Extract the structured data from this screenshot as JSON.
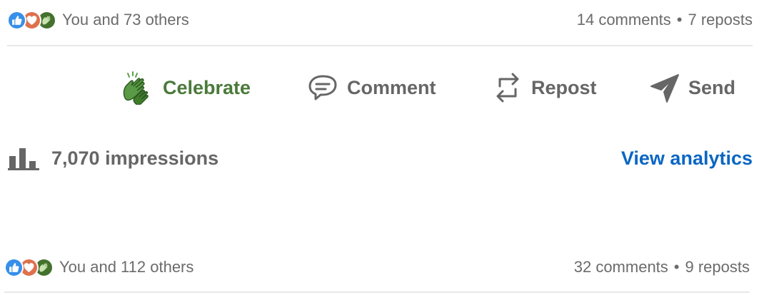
{
  "posts": [
    {
      "reactions_text": "You and 73 others",
      "comments": "14 comments",
      "separator": "•",
      "reposts": "7 reposts"
    },
    {
      "reactions_text": "You and 112 others",
      "comments": "32 comments",
      "separator": "•",
      "reposts": "9 reposts"
    }
  ],
  "actions": {
    "celebrate": {
      "label": "Celebrate",
      "icon": "celebrate-icon",
      "active": true
    },
    "comment": {
      "label": "Comment",
      "icon": "comment-icon"
    },
    "repost": {
      "label": "Repost",
      "icon": "repost-icon"
    },
    "send": {
      "label": "Send",
      "icon": "send-icon"
    }
  },
  "impressions": {
    "icon": "bar-chart-icon",
    "label": "7,070 impressions",
    "link": "View analytics"
  },
  "colors": {
    "like": "#378fe9",
    "love": "#df704d",
    "celebrate": "#44712e",
    "celebrate_active_text": "#4a7a3a",
    "link": "#0a66c2",
    "muted_text": "#666666",
    "divider": "#e8e8e8"
  }
}
